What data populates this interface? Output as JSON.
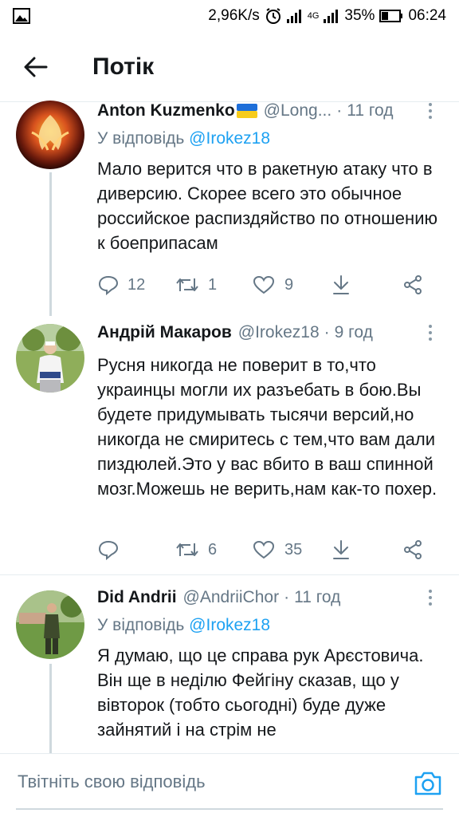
{
  "status_bar": {
    "speed": "2,96K/s",
    "network": "4G",
    "battery": "35%",
    "time": "06:24"
  },
  "header": {
    "title": "Потік"
  },
  "tweets": [
    {
      "name": "Anton Kuzmenko",
      "handle": "@Long...",
      "time": "11 год",
      "reply_prefix": "У відповідь",
      "reply_to": "@Irokez18",
      "text": "Мало верится что в ракетную атаку что в диверсию. Скорее всего это обычное российское распиздяйство по отношению к боеприпасам",
      "replies": "12",
      "retweets": "1",
      "likes": "9"
    },
    {
      "name": "Андрій Макаров",
      "handle": "@Irokez18",
      "time": "9 год",
      "text": "Русня никогда не поверит в то,что украинцы могли их разъебать в бою.Вы будете придумывать тысячи версий,но никогда не смиритесь с тем,что вам дали пиздюлей.Это у вас вбито в ваш спинной мозг.Можешь не верить,нам как-то похер.",
      "replies": "",
      "retweets": "6",
      "likes": "35"
    },
    {
      "name": "Did Andrii",
      "handle": "@AndriiChor",
      "time": "11 год",
      "reply_prefix": "У відповідь",
      "reply_to": "@Irokez18",
      "text": "Я думаю, що це справа рук Арєстовича. Він ще в неділю Фейгіну сказав, що у вівторок (тобто сьогодні) буде дуже зайнятий і на стрім не"
    }
  ],
  "reply_bar": {
    "placeholder": "Твітніть свою відповідь"
  },
  "colors": {
    "accent": "#1da1f2",
    "secondary_text": "#657786",
    "divider": "#e6ecf0"
  }
}
